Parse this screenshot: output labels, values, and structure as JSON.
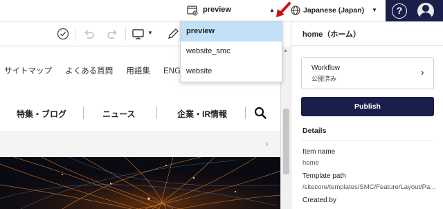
{
  "topbar": {
    "site_selector": {
      "value": "preview",
      "icon": "site-icon"
    },
    "language_selector": {
      "value": "Japanese (Japan)",
      "icon": "globe-icon"
    },
    "help_label": "?",
    "colors": {
      "dark": "#191e4a",
      "accent_arrow": "#cc1111"
    }
  },
  "site_dropdown": {
    "options": [
      {
        "label": "preview",
        "selected": true
      },
      {
        "label": "website_smc",
        "selected": false
      },
      {
        "label": "website",
        "selected": false
      }
    ]
  },
  "canvas": {
    "utility_nav": [
      "サイトマップ",
      "よくある質問",
      "用語集",
      "ENGLIS"
    ],
    "main_nav": [
      "特集・ブログ",
      "ニュース",
      "企業・IR情報"
    ]
  },
  "panel": {
    "title": "home（ホーム）",
    "workflow": {
      "label": "Workflow",
      "state": "公開済み"
    },
    "publish_label": "Publish",
    "details_heading": "Details",
    "fields": [
      {
        "label": "Item name",
        "value": "home"
      },
      {
        "label": "Template path",
        "value": "/sitecore/templates/SMC/Feature/Layout/Pa..."
      },
      {
        "label": "Created by",
        "value": ""
      }
    ]
  }
}
